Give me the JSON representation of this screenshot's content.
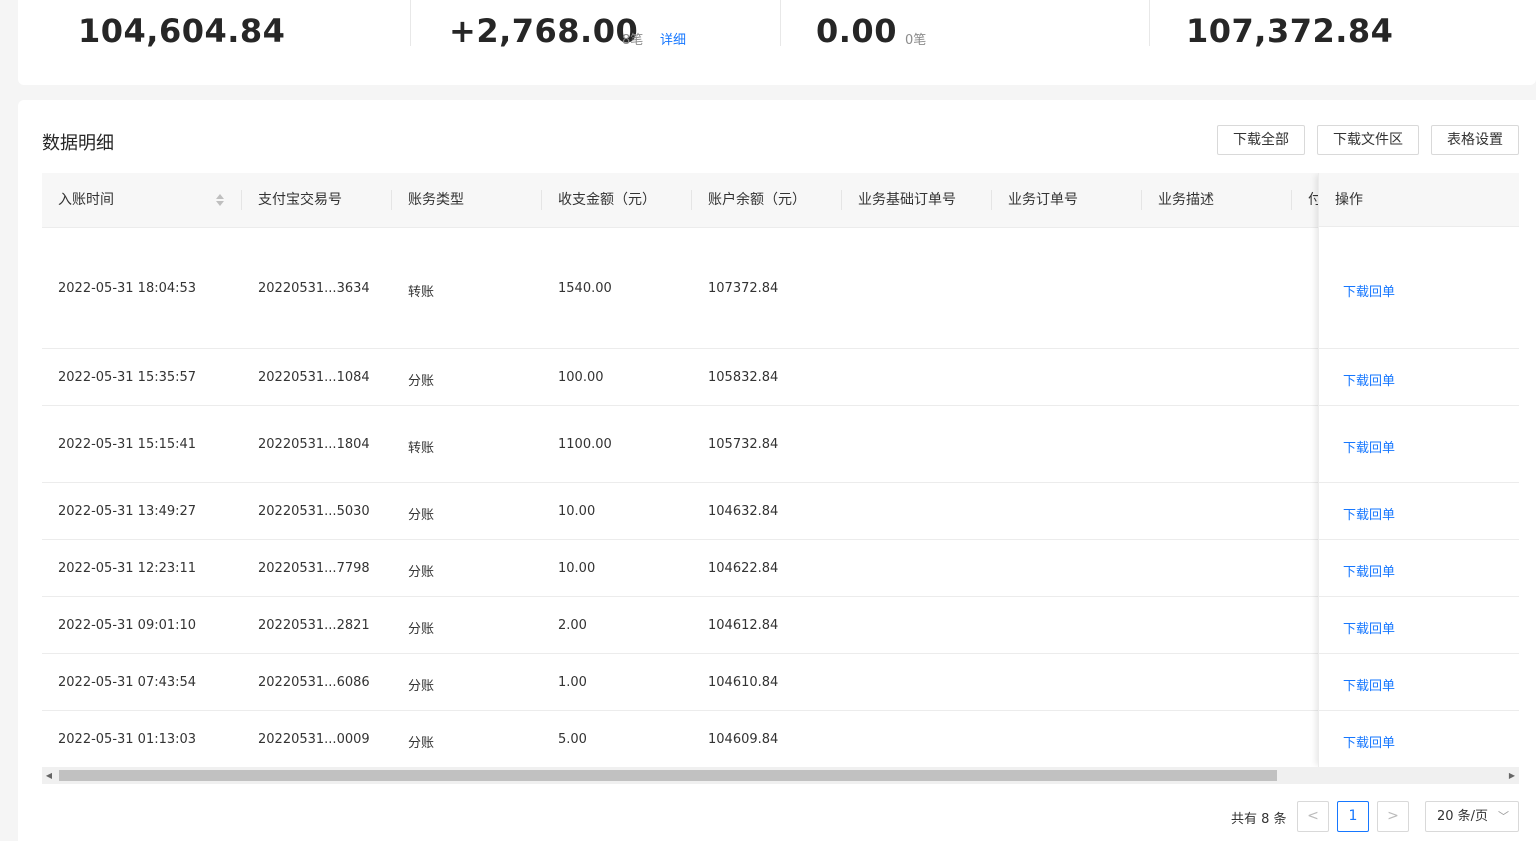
{
  "summary": [
    {
      "value": "104,604.84"
    },
    {
      "value": "+2,768.00",
      "count": "8笔",
      "link": "详细"
    },
    {
      "value": "0.00",
      "count": "0笔"
    },
    {
      "value": "107,372.84"
    }
  ],
  "section": {
    "title": "数据明细",
    "buttons": [
      "下载全部",
      "下载文件区",
      "表格设置"
    ]
  },
  "table": {
    "columns": [
      "入账时间",
      "支付宝交易号",
      "账务类型",
      "收支金额（元）",
      "账户余额（元）",
      "业务基础订单号",
      "业务订单号",
      "业务描述",
      "付"
    ],
    "op_header": "操作",
    "op_link": "下载回单",
    "rows": [
      {
        "time": "2022-05-31 18:04:53",
        "trade_no": "20220531...3634",
        "type": "转账",
        "amount": "1540.00",
        "balance": "107372.84"
      },
      {
        "time": "2022-05-31 15:35:57",
        "trade_no": "20220531...1084",
        "type": "分账",
        "amount": "100.00",
        "balance": "105832.84"
      },
      {
        "time": "2022-05-31 15:15:41",
        "trade_no": "20220531...1804",
        "type": "转账",
        "amount": "1100.00",
        "balance": "105732.84"
      },
      {
        "time": "2022-05-31 13:49:27",
        "trade_no": "20220531...5030",
        "type": "分账",
        "amount": "10.00",
        "balance": "104632.84"
      },
      {
        "time": "2022-05-31 12:23:11",
        "trade_no": "20220531...7798",
        "type": "分账",
        "amount": "10.00",
        "balance": "104622.84"
      },
      {
        "time": "2022-05-31 09:01:10",
        "trade_no": "20220531...2821",
        "type": "分账",
        "amount": "2.00",
        "balance": "104612.84"
      },
      {
        "time": "2022-05-31 07:43:54",
        "trade_no": "20220531...6086",
        "type": "分账",
        "amount": "1.00",
        "balance": "104610.84"
      },
      {
        "time": "2022-05-31 01:13:03",
        "trade_no": "20220531...0009",
        "type": "分账",
        "amount": "5.00",
        "balance": "104609.84"
      }
    ]
  },
  "pagination": {
    "total": "共有 8 条",
    "prev": "<",
    "current": "1",
    "next": ">",
    "page_size": "20 条/页"
  },
  "colors": {
    "link": "#1677ff",
    "text": "#333333"
  }
}
